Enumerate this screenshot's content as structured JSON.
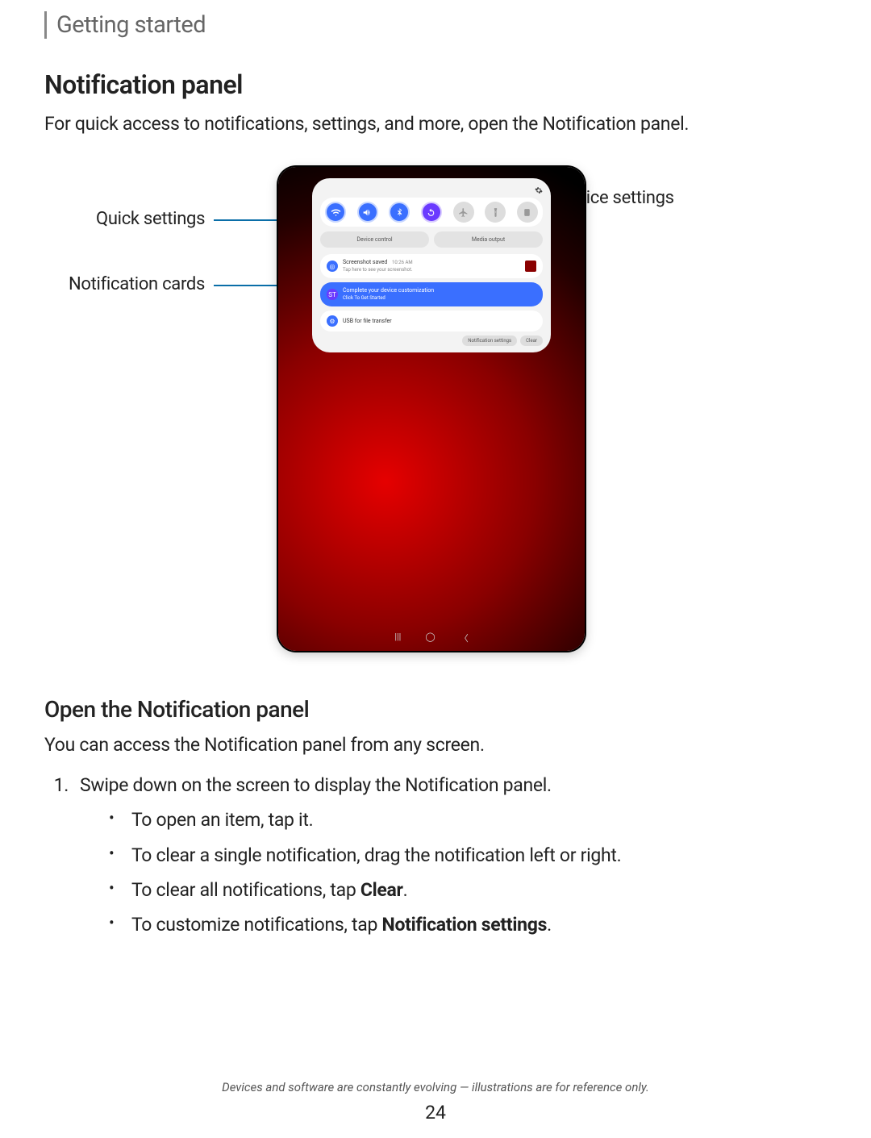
{
  "header": "Getting started",
  "title": "Notification panel",
  "intro": "For quick access to notifications, settings, and more, open the Notification panel.",
  "callouts": {
    "quick_settings": "Quick settings",
    "notification_cards": "Notification cards",
    "device_settings": "Device settings"
  },
  "device": {
    "pills": {
      "device_control": "Device control",
      "media_output": "Media output"
    },
    "notifs": [
      {
        "title": "Screenshot saved",
        "time": "10:26 AM",
        "sub": "Tap here to see your screenshot.",
        "icon_bg": "#3a6fff",
        "has_thumb": true,
        "blue": false
      },
      {
        "title": "Complete your device customization",
        "time": "",
        "sub": "Click To Get Started",
        "icon_bg": "#6a3aff",
        "has_thumb": false,
        "blue": true
      },
      {
        "title": "USB for file transfer",
        "time": "",
        "sub": "",
        "icon_bg": "#3a6fff",
        "has_thumb": false,
        "blue": false
      }
    ],
    "footer": {
      "settings": "Notification settings",
      "clear": "Clear"
    }
  },
  "section2": {
    "heading": "Open the Notification panel",
    "lead": "You can access the Notification panel from any screen.",
    "step1": "Swipe down on the screen to display the Notification panel.",
    "bullets": [
      "To open an item, tap it.",
      "To clear a single notification, drag the notification left or right.",
      {
        "pre": "To clear all notifications, tap ",
        "bold": "Clear",
        "post": "."
      },
      {
        "pre": "To customize notifications, tap ",
        "bold": "Notification settings",
        "post": "."
      }
    ]
  },
  "disclaimer": "Devices and software are constantly evolving — illustrations are for reference only.",
  "page_number": "24"
}
